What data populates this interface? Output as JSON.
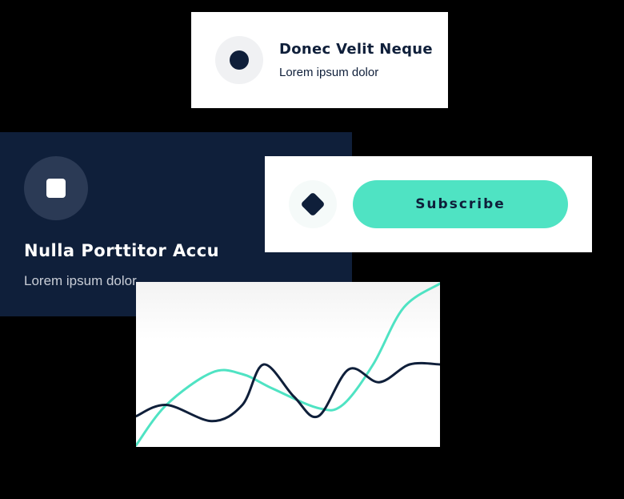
{
  "cards": {
    "top": {
      "title": "Donec Velit Neque",
      "subtitle": "Lorem ipsum dolor",
      "icon": "circle-dot-icon"
    },
    "navy": {
      "title": "Nulla Porttitor Accu",
      "subtitle": "Lorem ipsum dolor",
      "icon": "square-icon"
    },
    "subscribe": {
      "button_label": "Subscribe",
      "icon": "diamond-icon"
    }
  },
  "colors": {
    "navy": "#0f1f3a",
    "accent": "#4fe3c3",
    "white": "#ffffff"
  },
  "chart_data": {
    "type": "line",
    "title": "",
    "xlabel": "",
    "ylabel": "",
    "grid": false,
    "legend": "none",
    "xlim": [
      0,
      100
    ],
    "ylim": [
      0,
      100
    ],
    "series": [
      {
        "color": "#4fe3c3",
        "points": [
          [
            0,
            0
          ],
          [
            10,
            25
          ],
          [
            25,
            45
          ],
          [
            35,
            44
          ],
          [
            45,
            35
          ],
          [
            60,
            23
          ],
          [
            68,
            25
          ],
          [
            78,
            50
          ],
          [
            88,
            85
          ],
          [
            100,
            100
          ]
        ]
      },
      {
        "color": "#0f1f3a",
        "points": [
          [
            0,
            18
          ],
          [
            10,
            25
          ],
          [
            25,
            15
          ],
          [
            35,
            25
          ],
          [
            42,
            50
          ],
          [
            52,
            30
          ],
          [
            60,
            18
          ],
          [
            70,
            47
          ],
          [
            80,
            39
          ],
          [
            90,
            50
          ],
          [
            100,
            50
          ]
        ]
      }
    ]
  }
}
